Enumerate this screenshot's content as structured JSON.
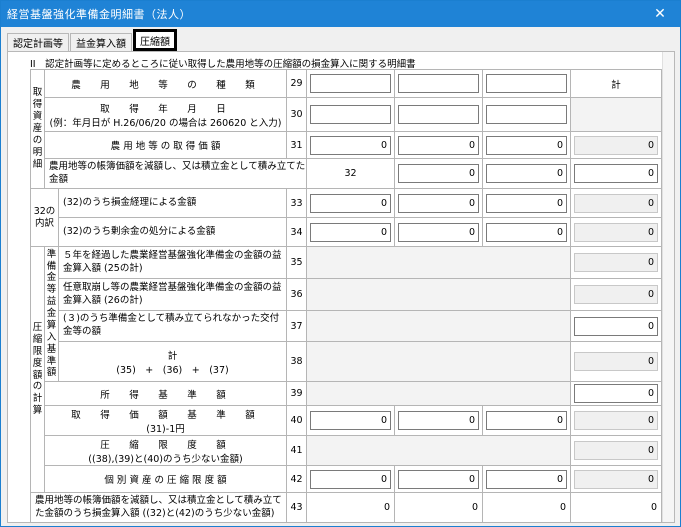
{
  "window": {
    "title": "経営基盤強化準備金明細書（法人）",
    "close_label": "✕"
  },
  "tabs": [
    {
      "label": "認定計画等"
    },
    {
      "label": "益金算入額"
    },
    {
      "label": "圧縮額"
    }
  ],
  "caption": "II　認定計画等に定めるところに従い取得した農用地等の圧縮額の損金算入に関する明細書",
  "groups": {
    "g1": "取得資産の明細",
    "g2": "32の内訳",
    "g3": "圧縮限度額の計算",
    "g4": "準備金等益金算入基準額"
  },
  "rows": {
    "r29": {
      "label": "農　用　地　等　の　種　類",
      "num": "29",
      "total_label": "計"
    },
    "r30": {
      "label1": "取　得　年　月　日",
      "label2": "(例：年月日が H.26/06/20 の場合は 260620 と入力)",
      "num": "30"
    },
    "r31": {
      "label": "農 用 地 等 の 取 得 価 額",
      "num": "31",
      "values": [
        "0",
        "0",
        "0",
        "0"
      ]
    },
    "r32": {
      "label": "農用地等の帳簿価額を減額し、又は積立金として積み立てた金額",
      "num": "32",
      "values": [
        "0",
        "0",
        "0",
        "0"
      ]
    },
    "r33": {
      "label": "(32)のうち損金経理による金額",
      "num": "33",
      "values": [
        "0",
        "0",
        "0",
        "0"
      ]
    },
    "r34": {
      "label": "(32)のうち剰余金の処分による金額",
      "num": "34",
      "values": [
        "0",
        "0",
        "0",
        "0"
      ]
    },
    "r35": {
      "label": "５年を経過した農業経営基盤強化準備金の金額の益金算入額 (25の計)",
      "num": "35",
      "value": "0"
    },
    "r36": {
      "label": "任意取崩し等の農業経営基盤強化準備金の金額の益金算入額 (26の計)",
      "num": "36",
      "value": "0"
    },
    "r37": {
      "label": "(３)のうち準備金として積み立てられなかった交付金等の額",
      "num": "37",
      "value": "0"
    },
    "r38": {
      "label1": "計",
      "label2": "(35)　+　(36)　+　(37)",
      "num": "38",
      "value": "0"
    },
    "r39": {
      "label": "所　得　基　準　額",
      "num": "39",
      "value": "0"
    },
    "r40": {
      "label1": "取　得　価　額　基　準　額",
      "label2": "(31)-1円",
      "num": "40",
      "values": [
        "0",
        "0",
        "0",
        "0"
      ]
    },
    "r41": {
      "label1": "圧　縮　限　度　額",
      "label2": "((38),(39)と(40)のうち少ない金額)",
      "num": "41",
      "value": "0"
    },
    "r42": {
      "label": "個 別 資 産 の 圧 縮 限 度 額",
      "num": "42",
      "values": [
        "0",
        "0",
        "0",
        "0"
      ]
    },
    "r43": {
      "label": "農用地等の帳簿価額を減額し、又は積立金として積み立てた金額のうち損金算入額 ((32)と(42)のうち少ない金額)",
      "num": "43",
      "values": [
        "0",
        "0",
        "0",
        "0"
      ]
    }
  }
}
